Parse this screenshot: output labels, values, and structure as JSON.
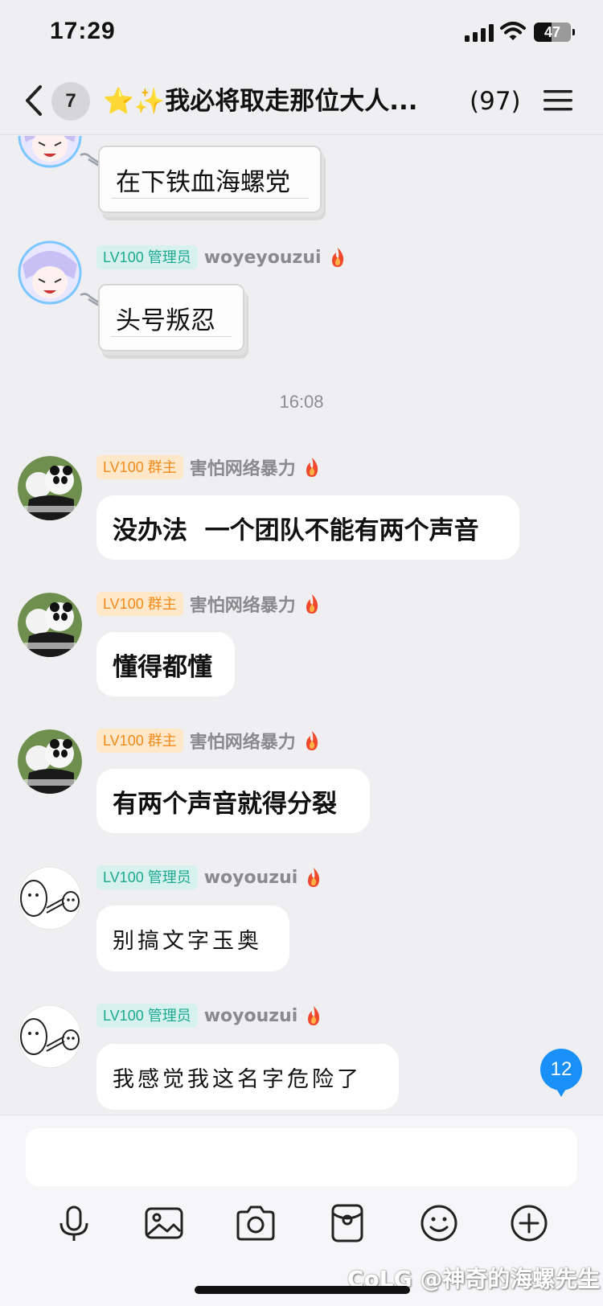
{
  "status_bar": {
    "time": "17:29",
    "battery": "47",
    "battery_level": 0.47
  },
  "header": {
    "unread_count": "7",
    "title": "⭐✨我必将取走那位大人...",
    "member_count": "(97)"
  },
  "messages": [
    {
      "text": "在下铁血海螺党"
    },
    {
      "badge": "LV100 管理员",
      "sender": "woyeyouzui",
      "text": "头号叛忍"
    },
    {
      "badge": "LV100 群主",
      "sender": "害怕网络暴力",
      "text": "没办法  一个团队不能有两个声音"
    },
    {
      "badge": "LV100 群主",
      "sender": "害怕网络暴力",
      "text": "懂得都懂"
    },
    {
      "badge": "LV100 群主",
      "sender": "害怕网络暴力",
      "text": "有两个声音就得分裂"
    },
    {
      "badge": "LV100 管理员",
      "sender": "woyouzui",
      "text": "别搞文字玉奥"
    },
    {
      "badge": "LV100 管理员",
      "sender": "woyouzui",
      "text": "我感觉我这名字危险了"
    }
  ],
  "timestamp": "16:08",
  "new_message_count": "12",
  "input": {
    "value": "",
    "placeholder": ""
  },
  "toolbar": [
    "microphone-icon",
    "image-icon",
    "camera-icon",
    "red-packet-icon",
    "emoji-icon",
    "plus-icon"
  ],
  "watermark": "CoLG @神奇的海螺先生",
  "colors": {
    "accent": "#1890f7",
    "admin_badge": "#1aa98f",
    "owner_badge": "#f28a1a",
    "flame": "#f0482c"
  }
}
